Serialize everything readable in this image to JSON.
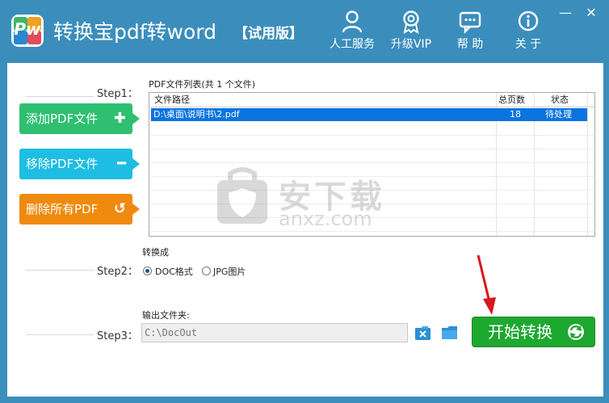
{
  "header": {
    "app_title": "转换宝pdf转word",
    "edition": "【试用版】",
    "logo_text": "Pw",
    "buttons": [
      {
        "label": "人工服务",
        "icon": "person-icon"
      },
      {
        "label": "升级VIP",
        "icon": "badge-icon"
      },
      {
        "label": "帮 助",
        "icon": "chat-icon"
      },
      {
        "label": "关 于",
        "icon": "info-icon"
      }
    ],
    "minimize": "—",
    "close": "✕"
  },
  "step1": {
    "label": "Step1：",
    "list_caption": "PDF文件列表(共 1 个文件)",
    "buttons": {
      "add": {
        "label": "添加PDF文件",
        "glyph": "✚"
      },
      "remove": {
        "label": "移除PDF文件",
        "glyph": "━"
      },
      "clear": {
        "label": "删除所有PDF",
        "glyph": "↺"
      }
    },
    "table": {
      "columns": [
        "文件路径",
        "总页数",
        "状态"
      ],
      "rows": [
        {
          "path": "D:\\桌面\\说明书\\2.pdf",
          "pages": "18",
          "status": "待处理"
        }
      ]
    }
  },
  "step2": {
    "label": "Step2：",
    "caption": "转换成",
    "options": [
      {
        "label": "DOC格式",
        "selected": true
      },
      {
        "label": "JPG图片",
        "selected": false
      }
    ]
  },
  "step3": {
    "label": "Step3：",
    "caption": "输出文件夹:",
    "output_path": "C:\\DocOut",
    "start_button": "开始转换"
  },
  "watermark": {
    "title": "安下载",
    "subtitle": "anxz.com"
  },
  "colors": {
    "title_bar": "#3b8ebc",
    "add": "#2fbf71",
    "remove": "#1ebde3",
    "clear": "#f08a0e",
    "start": "#1da830",
    "selection": "#0a74e0"
  }
}
